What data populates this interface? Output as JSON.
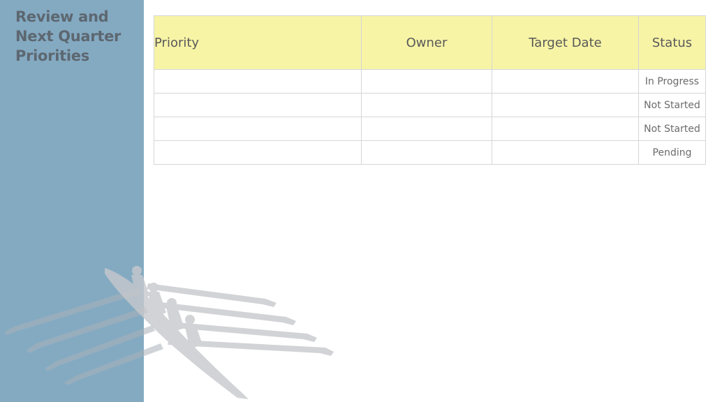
{
  "slide": {
    "title": "Review and Next Quarter Priorities"
  },
  "table": {
    "headers": {
      "priority": "Priority",
      "owner": "Owner",
      "target_date": "Target Date",
      "status": "Status"
    },
    "rows": [
      {
        "priority": "",
        "owner": "",
        "target_date": "",
        "status": "In Progress"
      },
      {
        "priority": "",
        "owner": "",
        "target_date": "",
        "status": "Not Started"
      },
      {
        "priority": "",
        "owner": "",
        "target_date": "",
        "status": "Not Started"
      },
      {
        "priority": "",
        "owner": "",
        "target_date": "",
        "status": "Pending"
      }
    ]
  },
  "colors": {
    "sidebar": "#84aac2",
    "header_fill": "#f7f4a6",
    "in_progress": "#f2d6ef",
    "not_started": "#eef3fa",
    "pending": "#fbe3d8",
    "title_text": "#5d6770"
  },
  "decoration": {
    "image": "rowing-crew-silhouette"
  }
}
